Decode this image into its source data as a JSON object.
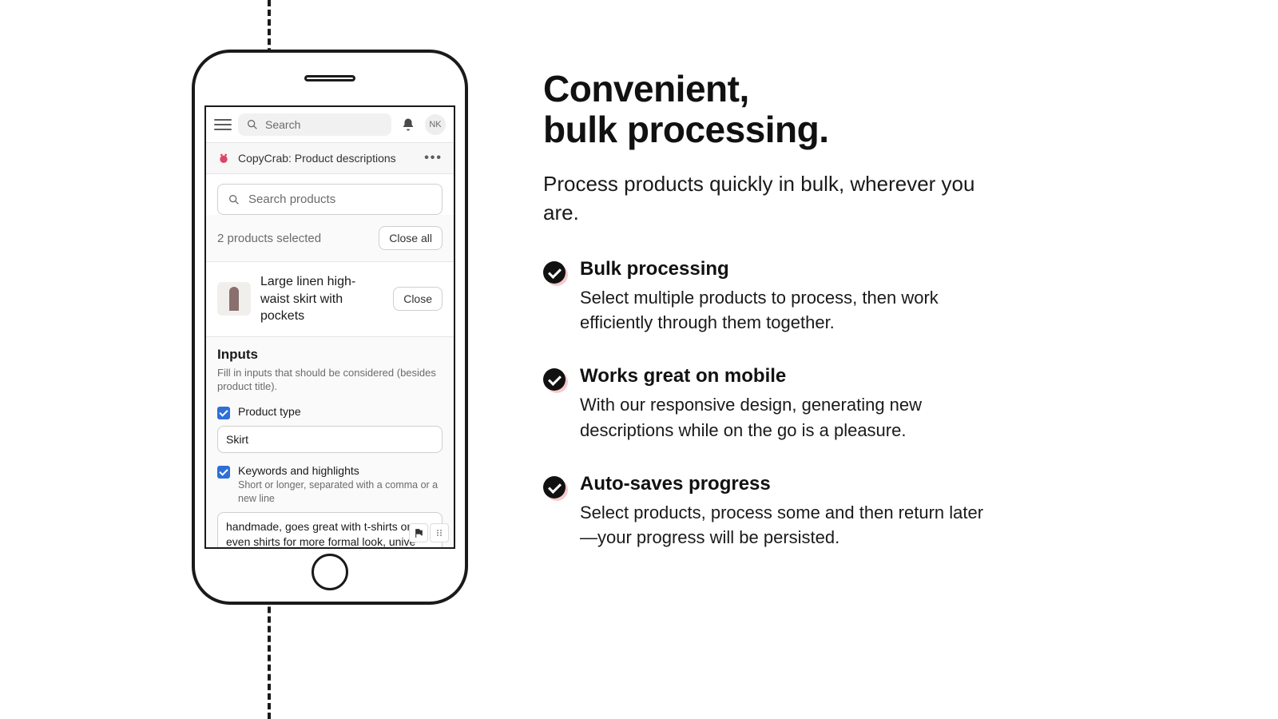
{
  "topbar": {
    "search_placeholder": "Search",
    "avatar_initials": "NK"
  },
  "app_row": {
    "title": "CopyCrab: Product descriptions"
  },
  "product_search_placeholder": "Search products",
  "selection": {
    "count_label": "2 products selected",
    "close_all_label": "Close all"
  },
  "product": {
    "title": "Large linen high-waist skirt with pockets",
    "close_label": "Close"
  },
  "inputs": {
    "heading": "Inputs",
    "sub": "Fill in inputs that should be considered (besides product title).",
    "product_type": {
      "label": "Product type",
      "value": "Skirt"
    },
    "keywords": {
      "label": "Keywords and highlights",
      "help": "Short or longer, separated with a comma or a new line",
      "value": "handmade, goes great with t-shirts or even shirts for more formal look, unive great for traveling because of how"
    }
  },
  "marketing": {
    "headline_line1": "Convenient,",
    "headline_line2": "bulk processing.",
    "sub": "Process products quickly in bulk, wherever you are.",
    "features": [
      {
        "title": "Bulk processing",
        "body": "Select multiple products to process, then work efficiently through them together."
      },
      {
        "title": "Works great on mobile",
        "body": "With our responsive design, generating new descriptions while on the go is a pleasure."
      },
      {
        "title": "Auto-saves progress",
        "body": "Select products, process some and then return later—your progress will be persisted."
      }
    ]
  }
}
